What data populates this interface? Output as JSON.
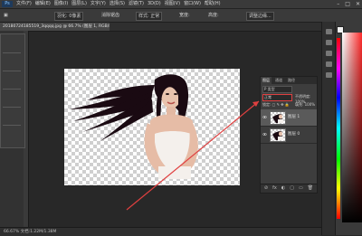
{
  "app": {
    "logo": "Ps",
    "menus": [
      "文件(F)",
      "编辑(E)",
      "图像(I)",
      "图层(L)",
      "文字(Y)",
      "选择(S)",
      "滤镜(T)",
      "3D(D)",
      "视图(V)",
      "窗口(W)",
      "帮助(H)"
    ],
    "window_controls": [
      "–",
      "□",
      "✕"
    ]
  },
  "options_bar": {
    "items": [
      "▣",
      "羽化: 0像素",
      "消除锯齿",
      "样式: 正常",
      "宽度:",
      "高度:",
      "调整边缘..."
    ]
  },
  "document": {
    "tab_label": "20180724185519_3qqqq.jpg @ 66.7% (图层 1, RGB/8) *"
  },
  "layers_panel": {
    "tabs": [
      "图层",
      "通道",
      "路径"
    ],
    "filter_label": "P 类型",
    "blend_mode": "正常",
    "opacity_label": "不透明度: 100%",
    "lock_label": "锁定: ▢ ✎ ✥ 🔒",
    "fill_label": "填充: 100%",
    "layers": [
      {
        "name": "图层 1",
        "selected": true
      },
      {
        "name": "图层 0",
        "selected": false
      }
    ],
    "footer_icons": [
      "⊘",
      "fx",
      "◐",
      "▢",
      "▭",
      "🗑"
    ]
  },
  "status": {
    "text": "66.67%   文档:1.22M/1.38M"
  },
  "colors": {
    "accent_red": "#e04040",
    "panel_bg": "#3d3d3d",
    "selected_layer": "#5a5a5a"
  }
}
